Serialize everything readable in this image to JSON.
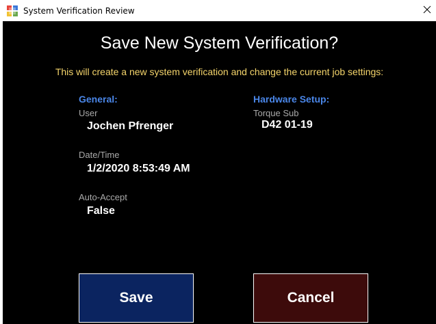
{
  "window": {
    "title": "System Verification Review",
    "close_symbol": "×"
  },
  "dialog": {
    "heading": "Save New System Verification?",
    "subtitle": "This will create a new system verification and change the current job settings:"
  },
  "general": {
    "section_label": "General:",
    "fields": [
      {
        "label": "User",
        "value": "Jochen Pfrenger"
      },
      {
        "label": "Date/Time",
        "value": "1/2/2020 8:53:49 AM"
      },
      {
        "label": "Auto-Accept",
        "value": "False"
      }
    ]
  },
  "hardware": {
    "section_label": "Hardware Setup:",
    "fields": [
      {
        "label": "Torque Sub",
        "value": "D42 01-19"
      }
    ]
  },
  "buttons": {
    "save_label": "Save",
    "cancel_label": "Cancel"
  },
  "colors": {
    "background": "#000000",
    "heading": "#ffffff",
    "subtitle": "#f5d56b",
    "section_label": "#4a86e8",
    "field_label": "#aaaaaa",
    "save_button": "#0b2460",
    "cancel_button": "#3d0b0b"
  },
  "icons": {
    "app": "app-window-icon",
    "close": "close-icon"
  }
}
